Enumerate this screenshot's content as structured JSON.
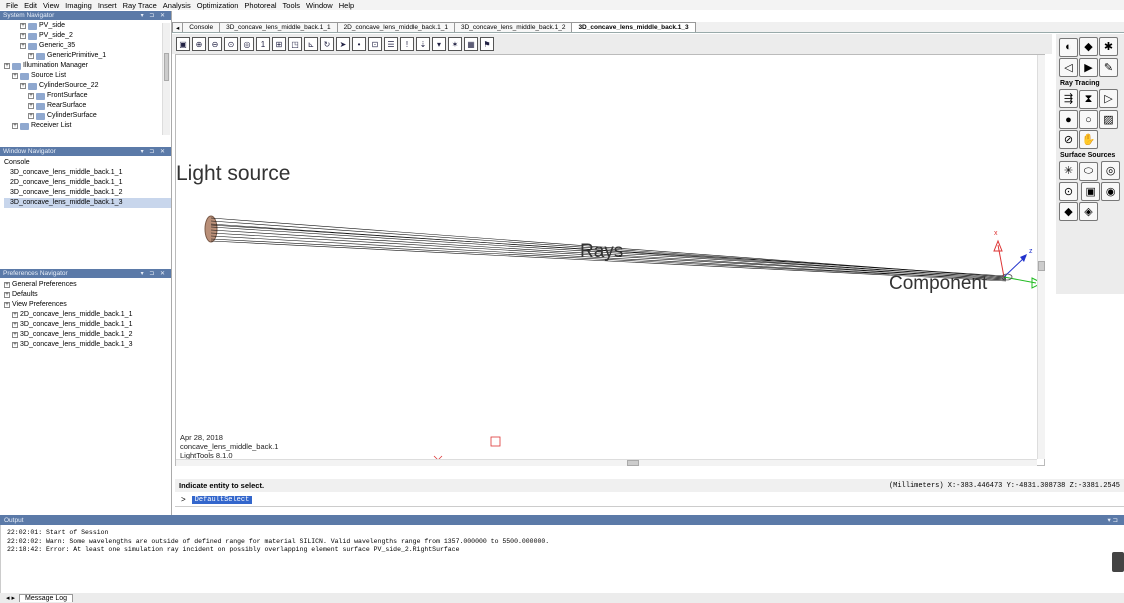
{
  "menu": [
    "File",
    "Edit",
    "View",
    "Imaging",
    "Insert",
    "Ray Trace",
    "Analysis",
    "Optimization",
    "Photoreal",
    "Tools",
    "Window",
    "Help"
  ],
  "system_navigator": {
    "title": "System Navigator",
    "items": [
      {
        "label": "PV_side",
        "indent": 2
      },
      {
        "label": "PV_side_2",
        "indent": 2
      },
      {
        "label": "Generic_35",
        "indent": 2
      },
      {
        "label": "GenericPrimitive_1",
        "indent": 3
      },
      {
        "label": "Illumination Manager",
        "indent": 0
      },
      {
        "label": "Source List",
        "indent": 1
      },
      {
        "label": "CylinderSource_22",
        "indent": 2
      },
      {
        "label": "FrontSurface",
        "indent": 3
      },
      {
        "label": "RearSurface",
        "indent": 3
      },
      {
        "label": "CylinderSurface",
        "indent": 3
      },
      {
        "label": "Receiver List",
        "indent": 1
      }
    ]
  },
  "window_navigator": {
    "title": "Window Navigator",
    "items": [
      "Console",
      "3D_concave_lens_middle_back.1_1",
      "2D_concave_lens_middle_back.1_1",
      "3D_concave_lens_middle_back.1_2",
      "3D_concave_lens_middle_back.1_3"
    ],
    "selected_index": 4
  },
  "preferences_navigator": {
    "title": "Preferences Navigator",
    "items": [
      {
        "label": "General Preferences",
        "indent": 0
      },
      {
        "label": "Defaults",
        "indent": 0
      },
      {
        "label": "View Preferences",
        "indent": 0
      },
      {
        "label": "2D_concave_lens_middle_back.1_1",
        "indent": 1
      },
      {
        "label": "3D_concave_lens_middle_back.1_1",
        "indent": 1
      },
      {
        "label": "3D_concave_lens_middle_back.1_2",
        "indent": 1
      },
      {
        "label": "3D_concave_lens_middle_back.1_3",
        "indent": 1
      }
    ]
  },
  "tabs": [
    "Console",
    "3D_concave_lens_middle_back.1_1",
    "2D_concave_lens_middle_back.1_1",
    "3D_concave_lens_middle_back.1_2",
    "3D_concave_lens_middle_back.1_3"
  ],
  "active_tab_index": 4,
  "viewport": {
    "annotation_light_source": "Light source",
    "annotation_rays": "Rays",
    "annotation_component": "Component",
    "axis_x": "x",
    "axis_z": "z",
    "info_date": "Apr 28, 2018",
    "info_model": "concave_lens_middle_back.1",
    "info_version": "LightTools 8.1.0"
  },
  "right_tools": {
    "ray_tracing_heading": "Ray Tracing",
    "surface_sources_heading": "Surface Sources"
  },
  "status": {
    "prompt": "Indicate entity to select.",
    "coords": "(Millimeters) X:-383.446473 Y:-4831.308738 Z:-3381.2545"
  },
  "command": {
    "caret": ">",
    "value": "DefaultSelect"
  },
  "output": {
    "title": "Output",
    "lines": [
      "22:02:01: Start of Session",
      "22:02:02: Warn: Some wavelengths are outside of defined range for material SILICN.  Valid wavelengths range from 1357.000000 to 5500.000000.",
      "22:18:42: Error: At least one simulation ray incident on possibly overlapping element surface PV_side_2.RightSurface"
    ],
    "tab": "Message Log"
  },
  "colors": {
    "panel_title": "#5b7aa8",
    "selection": "#3366cc",
    "light_source": "#b98f78"
  }
}
